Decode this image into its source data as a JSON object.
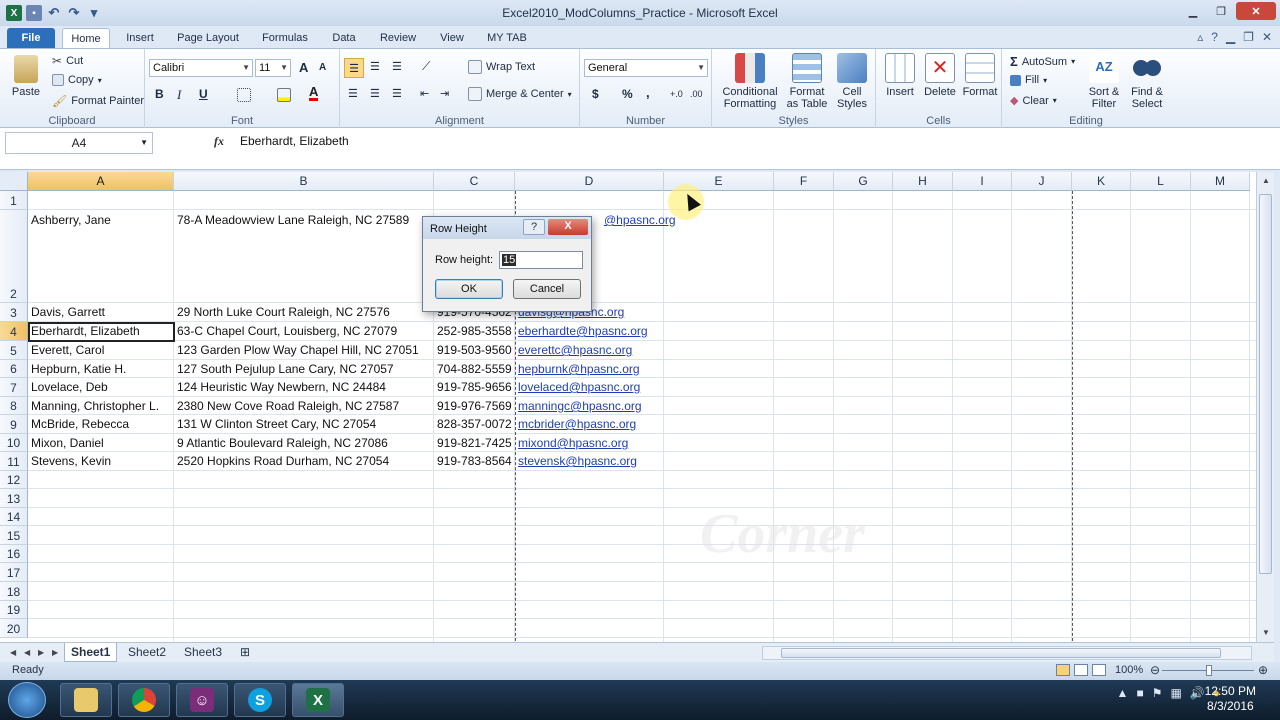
{
  "window": {
    "title": "Excel2010_ModColumns_Practice - Microsoft Excel"
  },
  "tabs": [
    {
      "label": "File"
    },
    {
      "label": "Home"
    },
    {
      "label": "Insert"
    },
    {
      "label": "Page Layout"
    },
    {
      "label": "Formulas"
    },
    {
      "label": "Data"
    },
    {
      "label": "Review"
    },
    {
      "label": "View"
    },
    {
      "label": "MY TAB"
    }
  ],
  "ribbon": {
    "clipboard": {
      "paste": "Paste",
      "cut": "Cut",
      "copy": "Copy",
      "format_painter": "Format Painter",
      "label": "Clipboard"
    },
    "font": {
      "name": "Calibri",
      "size": "11",
      "bold": "B",
      "italic": "I",
      "underline": "U",
      "grow": "A",
      "shrink": "A",
      "label": "Font"
    },
    "alignment": {
      "wrap_text": "Wrap Text",
      "merge_center": "Merge & Center",
      "label": "Alignment"
    },
    "number": {
      "format": "General",
      "currency": "$",
      "percent": "%",
      "comma": ",",
      "inc_decimal": "+.0",
      "dec_decimal": ".00",
      "label": "Number"
    },
    "styles": {
      "conditional": "Conditional",
      "formatting": "Formatting",
      "format": "Format",
      "as_table": "as Table",
      "cell": "Cell",
      "cell_styles": "Styles",
      "label": "Styles"
    },
    "cells": {
      "insert": "Insert",
      "delete": "Delete",
      "format": "Format",
      "label": "Cells"
    },
    "editing": {
      "autosum": "AutoSum",
      "fill": "Fill",
      "clear": "Clear",
      "sort": "Sort &",
      "filter": "Filter",
      "find": "Find &",
      "select": "Select",
      "label": "Editing"
    }
  },
  "formula_bar": {
    "name_box": "A4",
    "fx": "fx",
    "content": "Eberhardt, Elizabeth"
  },
  "columns": [
    "A",
    "B",
    "C",
    "D",
    "E",
    "F",
    "G",
    "H",
    "I",
    "J",
    "K",
    "L",
    "M"
  ],
  "rows": [
    "1",
    "2",
    "3",
    "4",
    "5",
    "6",
    "7",
    "8",
    "9",
    "10",
    "11",
    "12",
    "13",
    "14",
    "15",
    "16",
    "17",
    "18",
    "19",
    "20"
  ],
  "data_rows": [
    {
      "a": "Ashberry, Jane",
      "b": "78-A Meadowview Lane Raleigh, NC 27589",
      "c": "",
      "d": "@hpasnc.org"
    },
    {
      "a": "Davis, Garrett",
      "b": "29 North Luke Court Raleigh, NC 27576",
      "c": "919-570-4562",
      "d": "davisg@hpasnc.org"
    },
    {
      "a": "Eberhardt, Elizabeth",
      "b": "63-C Chapel Court, Louisberg, NC 27079",
      "c": "252-985-3558",
      "d": "eberhardte@hpasnc.org"
    },
    {
      "a": "Everett, Carol",
      "b": "123 Garden Plow Way Chapel Hill, NC 27051",
      "c": "919-503-9560",
      "d": "everettc@hpasnc.org"
    },
    {
      "a": "Hepburn, Katie H.",
      "b": "127 South Pejulup Lane Cary, NC 27057",
      "c": "704-882-5559",
      "d": "hepburnk@hpasnc.org"
    },
    {
      "a": "Lovelace, Deb",
      "b": "124 Heuristic Way Newbern, NC 24484",
      "c": "919-785-9656",
      "d": "lovelaced@hpasnc.org"
    },
    {
      "a": "Manning, Christopher L.",
      "b": "2380 New Cove Road Raleigh, NC 27587",
      "c": "919-976-7569",
      "d": "manningc@hpasnc.org"
    },
    {
      "a": "McBride, Rebecca",
      "b": "131 W Clinton Street Cary, NC 27054",
      "c": "828-357-0072",
      "d": "mcbrider@hpasnc.org"
    },
    {
      "a": "Mixon, Daniel",
      "b": "9 Atlantic Boulevard Raleigh, NC 27086",
      "c": "919-821-7425",
      "d": "mixond@hpasnc.org"
    },
    {
      "a": "Stevens, Kevin",
      "b": "2520 Hopkins Road Durham, NC 27054",
      "c": "919-783-8564",
      "d": "stevensk@hpasnc.org"
    }
  ],
  "sheets": [
    {
      "label": "Sheet1"
    },
    {
      "label": "Sheet2"
    },
    {
      "label": "Sheet3"
    }
  ],
  "status": {
    "ready": "Ready",
    "zoom": "100%"
  },
  "dialog": {
    "title": "Row Height",
    "help": "?",
    "close": "X",
    "label": "Row height:",
    "value": "15",
    "ok": "OK",
    "cancel": "Cancel"
  },
  "taskbar": {
    "time": "12:50 PM",
    "date": "8/3/2016"
  },
  "colors": {
    "accent": "#2c6fbb",
    "selected_header": "#f1c15f",
    "link": "#1f3fb0"
  }
}
